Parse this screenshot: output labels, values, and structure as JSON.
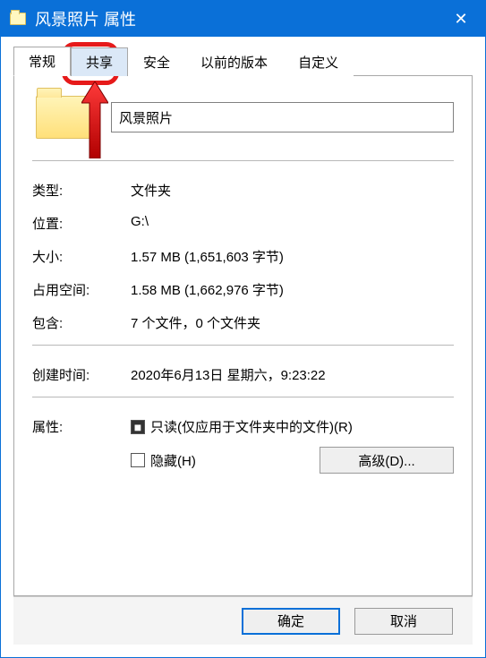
{
  "title": "风景照片 属性",
  "tabs": [
    "常规",
    "共享",
    "安全",
    "以前的版本",
    "自定义"
  ],
  "active_tab_index": 0,
  "highlighted_tab_index": 1,
  "folder_name": "风景照片",
  "rows": {
    "type_label": "类型:",
    "type_value": "文件夹",
    "location_label": "位置:",
    "location_value": "G:\\",
    "size_label": "大小:",
    "size_value": "1.57 MB (1,651,603 字节)",
    "disk_label": "占用空间:",
    "disk_value": "1.58 MB (1,662,976 字节)",
    "contains_label": "包含:",
    "contains_value": "7 个文件，0 个文件夹",
    "created_label": "创建时间:",
    "created_value": "2020年6月13日 星期六，9:23:22"
  },
  "attributes": {
    "label": "属性:",
    "readonly_label": "只读(仅应用于文件夹中的文件)(R)",
    "hidden_label": "隐藏(H)"
  },
  "buttons": {
    "advanced": "高级(D)...",
    "ok": "确定",
    "cancel": "取消"
  }
}
